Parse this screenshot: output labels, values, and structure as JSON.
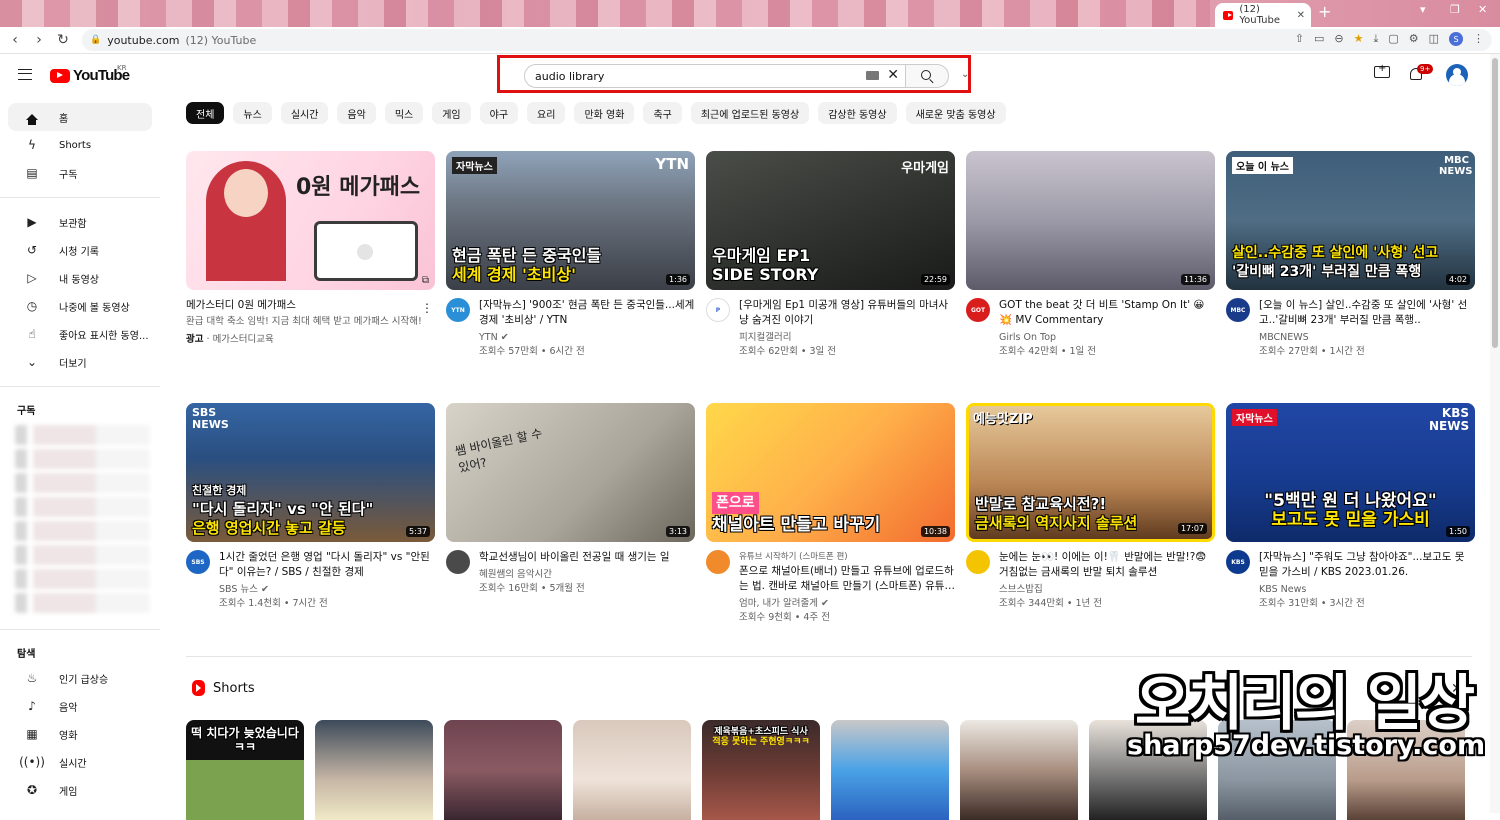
{
  "browser": {
    "tab_title": "(12) YouTube",
    "url_host": "youtube.com",
    "url_title": "(12) YouTube",
    "new_tab": "+",
    "profile_initial": "S"
  },
  "masthead": {
    "logo": "YouTube",
    "region": "KR",
    "search_value": "audio library",
    "notifications_badge": "9+"
  },
  "sidebar": {
    "primary": [
      {
        "label": "홈",
        "icon": "home-icon"
      },
      {
        "label": "Shorts",
        "icon": "shorts-icon"
      },
      {
        "label": "구독",
        "icon": "subscriptions-icon"
      }
    ],
    "library": [
      {
        "label": "보관함",
        "icon": "library-icon"
      },
      {
        "label": "시청 기록",
        "icon": "history-icon"
      },
      {
        "label": "내 동영상",
        "icon": "my-videos-icon"
      },
      {
        "label": "나중에 볼 동영상",
        "icon": "watch-later-icon"
      },
      {
        "label": "좋아요 표시한 동영...",
        "icon": "like-icon"
      },
      {
        "label": "더보기",
        "icon": "chevron-down-icon"
      }
    ],
    "subscriptions_heading": "구독",
    "explore_heading": "탐색",
    "explore": [
      {
        "label": "인기 급상승",
        "icon": "trending-icon"
      },
      {
        "label": "음악",
        "icon": "music-icon"
      },
      {
        "label": "영화",
        "icon": "movie-icon"
      },
      {
        "label": "실시간",
        "icon": "live-icon"
      },
      {
        "label": "게임",
        "icon": "gaming-icon"
      }
    ]
  },
  "chips": [
    "전체",
    "뉴스",
    "실시간",
    "음악",
    "믹스",
    "게임",
    "야구",
    "요리",
    "만화 영화",
    "축구",
    "최근에 업로드된 동영상",
    "감상한 동영상",
    "새로운 맞춤 동영상"
  ],
  "videos_row1": [
    {
      "title": "메가스터디 0원 메가패스",
      "desc": "환급 대학 축소 임박! 지금 최대 혜택 받고 메가패스 시작해!",
      "ad_label": "광고",
      "ad_channel": "메가스터디교육",
      "caption": "0원 메가패스",
      "duration": "",
      "channel_color": "#ffffff",
      "channel_abbr": ""
    },
    {
      "title": "[자막뉴스] '900조' 현금 폭탄 든 중국인들...세계 경제 '초비상' / YTN",
      "channel": "YTN",
      "stats": "조회수 57만회 • 6시간 전",
      "caption_a": "현금 폭탄 든 중국인들",
      "caption_b": "세계 경제 '초비상'",
      "tag": "자막뉴스",
      "corner": "YTN",
      "duration": "1:36",
      "channel_color": "#2a8fd6",
      "channel_abbr": "YTN"
    },
    {
      "title": "[우마게임 Ep1 미공개 영상] 유튜버들의 마녀사냥 숨겨진 이야기",
      "channel": "피지컬갤러리",
      "stats": "조회수 62만회 • 3일 전",
      "caption_a": "우마게임 EP1",
      "caption_b": "SIDE STORY",
      "corner": "우마게임",
      "duration": "22:59",
      "channel_color": "#ffffff",
      "channel_abbr": "P"
    },
    {
      "title": "GOT the beat 갓 더 비트 'Stamp On It' 😀💥 MV Commentary",
      "channel": "Girls On Top",
      "stats": "조회수 42만회 • 1일 전",
      "duration": "11:36",
      "channel_color": "#d91c1c",
      "channel_abbr": "GOT"
    },
    {
      "title": "[오늘 이 뉴스] 살인..수감중 또 살인에 '사형' 선고..'갈비뼈 23개' 부러질 만큼 폭행..",
      "channel": "MBCNEWS",
      "stats": "조회수 27만회 • 1시간 전",
      "caption_a": "살인..수감중 또 살인에 '사형' 선고",
      "caption_b": "'갈비뼈 23개' 부러질 만큼 폭행",
      "tag": "오늘 이 뉴스",
      "corner": "MBC NEWS",
      "duration": "4:02",
      "channel_color": "#1a3a8a",
      "channel_abbr": "MBC"
    }
  ],
  "videos_row2": [
    {
      "title": "1시간 줄었던 은행 영업 \"다시 돌리자\" vs \"안된다\" 이유는? / SBS / 친절한 경제",
      "channel": "SBS 뉴스",
      "stats": "조회수 1.4천회 • 7시간 전",
      "tag": "친절한 경제",
      "caption_a": "\"다시 돌리자\" vs \"안 된다\"",
      "caption_b": "은행 영업시간 놓고 갈등",
      "corner": "SBS NEWS",
      "duration": "5:37",
      "channel_color": "#1d66c4",
      "channel_abbr": "SBS"
    },
    {
      "title": "학교선생님이 바이올린 전공일 때 생기는 일",
      "channel": "혜원쌤의 음악시간",
      "stats": "조회수 16만회 • 5개월 전",
      "caption_a": "쌤 바이올린 할 수 있어?",
      "duration": "3:13",
      "channel_color": "#4a4a4a",
      "channel_abbr": ""
    },
    {
      "title": "폰으로 채널아트(배너) 만들고 유튜브에 업로드하는 법. 캔바로 채널아트 만들기 (스마트폰) 유튜브 시작하기",
      "channel": "엄마, 내가 알려줄게",
      "stats": "조회수 9천회 • 4주 전",
      "sub": "유튜브 시작하기 (스마트폰 편)",
      "caption_a": "폰으로",
      "caption_b": "채널아트 만들고 바꾸기",
      "duration": "10:38",
      "channel_color": "#f08a2a",
      "channel_abbr": ""
    },
    {
      "title": "눈에는 눈👀! 이에는 이!🦷 반말에는 반말!?😨 거침없는 금새록의 반말 퇴치 솔루션",
      "channel": "스브스밥집",
      "stats": "조회수 344만회 • 1년 전",
      "tag": "예능맛ZIP",
      "caption_a": "반말로 참교육시전?!",
      "caption_b": "금새록의 역지사지 솔루션",
      "duration": "17:07",
      "channel_color": "#f5c400",
      "channel_abbr": ""
    },
    {
      "title": "[자막뉴스] \"주워도 그냥 참아야죠\"...보고도 못 믿을 가스비 / KBS 2023.01.26.",
      "channel": "KBS News",
      "stats": "조회수 31만회 • 3시간 전",
      "tag": "자막뉴스",
      "caption_a": "\"5백만 원 더 나왔어요\"",
      "caption_b": "보고도 못 믿을 가스비",
      "corner": "KBS NEWS",
      "duration": "1:50",
      "channel_color": "#0d3a8f",
      "channel_abbr": "KBS"
    }
  ],
  "shorts": {
    "heading": "Shorts",
    "close": "✕",
    "items": [
      {
        "caption": "떡 치다가 늦었습니다ㅋㅋ"
      },
      {
        "caption": ""
      },
      {
        "caption": ""
      },
      {
        "caption": ""
      },
      {
        "caption": "제육볶음+초스피드 식사",
        "caption2": "적응 못하는 주현영ㅋㅋㅋ"
      },
      {
        "caption": ""
      },
      {
        "caption": ""
      },
      {
        "caption": ""
      },
      {
        "caption": ""
      },
      {
        "caption": ""
      }
    ]
  },
  "watermark": {
    "line1": "오치리의 일상",
    "line2": "sharp57dev.tistory.com"
  }
}
